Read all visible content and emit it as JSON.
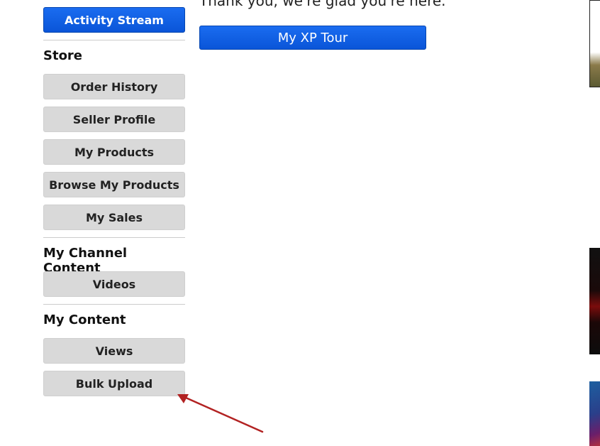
{
  "sidebar": {
    "activity_stream_label": "Activity Stream",
    "store": {
      "title": "Store",
      "items": [
        "Order History",
        "Seller Profile",
        "My Products",
        "Browse My Products",
        "My Sales"
      ]
    },
    "channel": {
      "title": "My Channel Content",
      "items": [
        "Videos"
      ]
    },
    "content": {
      "title": "My Content",
      "items": [
        "Views",
        "Bulk Upload"
      ]
    }
  },
  "main": {
    "thanks_text": "Thank you, we're glad you're here.",
    "tour_button_label": "My XP Tour"
  },
  "colors": {
    "primary_button": "#0a5ce0",
    "gray_button": "#d9d9d9",
    "annotation_arrow": "#b22222"
  }
}
